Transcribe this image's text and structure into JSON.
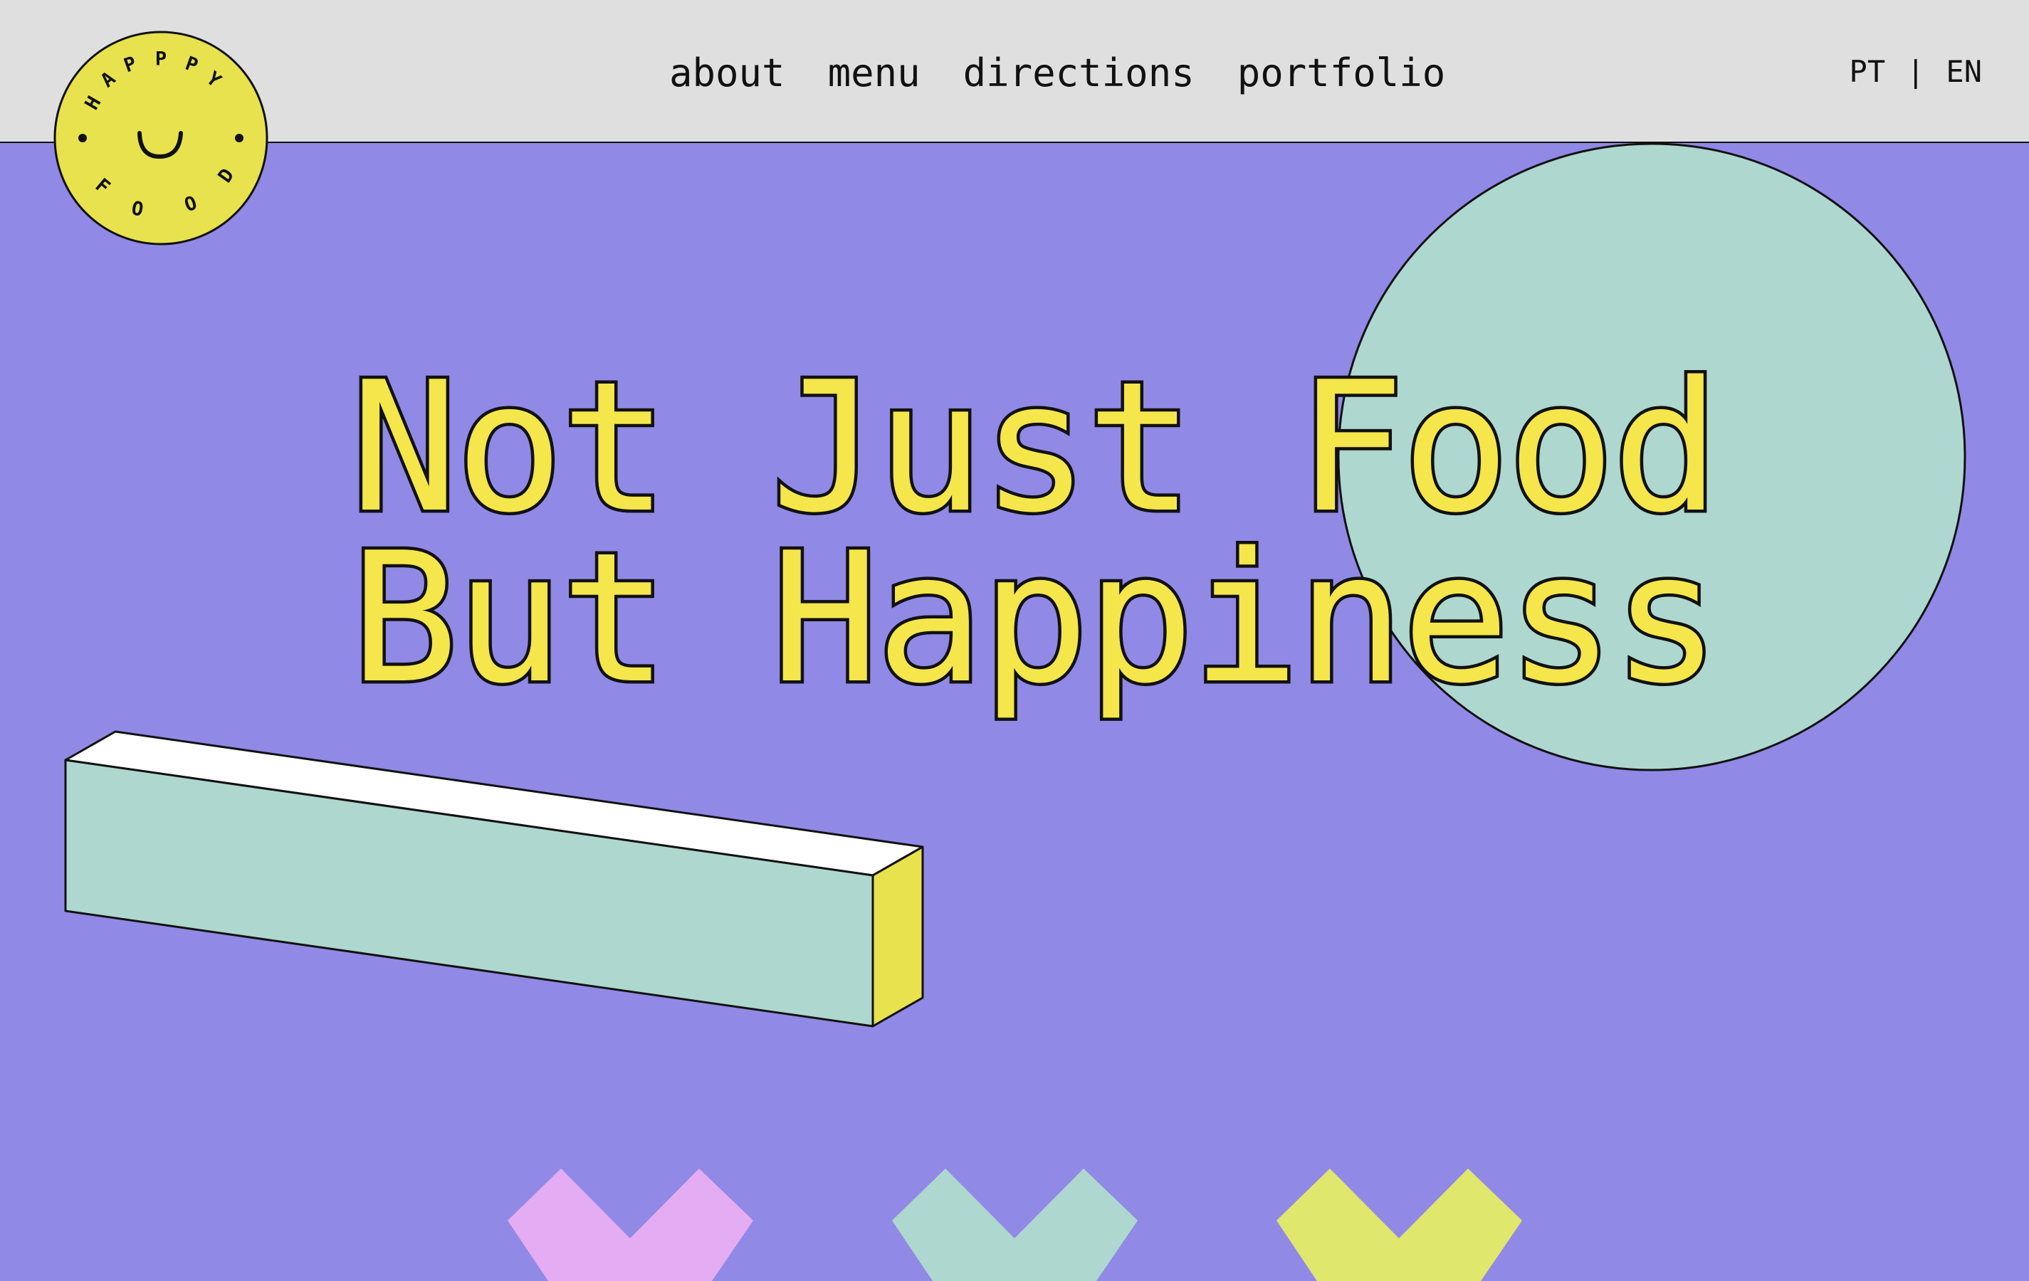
{
  "brand": {
    "logo_text": "HAPPY FOOD",
    "logo_color": "#e7e24e"
  },
  "nav": {
    "items": [
      {
        "label": "about"
      },
      {
        "label": "menu"
      },
      {
        "label": "directions"
      },
      {
        "label": "portfolio"
      }
    ]
  },
  "language": {
    "options": [
      "PT",
      "EN"
    ],
    "separator": "|"
  },
  "hero": {
    "line1": "Not Just Food",
    "line2": "But Happiness",
    "text_color": "#f4e64b"
  },
  "colors": {
    "background": "#9189e6",
    "header_background": "#dfdfdf",
    "mint": "#aed7cf",
    "yellow": "#e7e24e",
    "pink": "#e4acf2",
    "lime": "#dfe76c"
  },
  "decorations": {
    "chevrons": [
      "pink-chevron",
      "mint-chevron",
      "lime-chevron"
    ]
  }
}
